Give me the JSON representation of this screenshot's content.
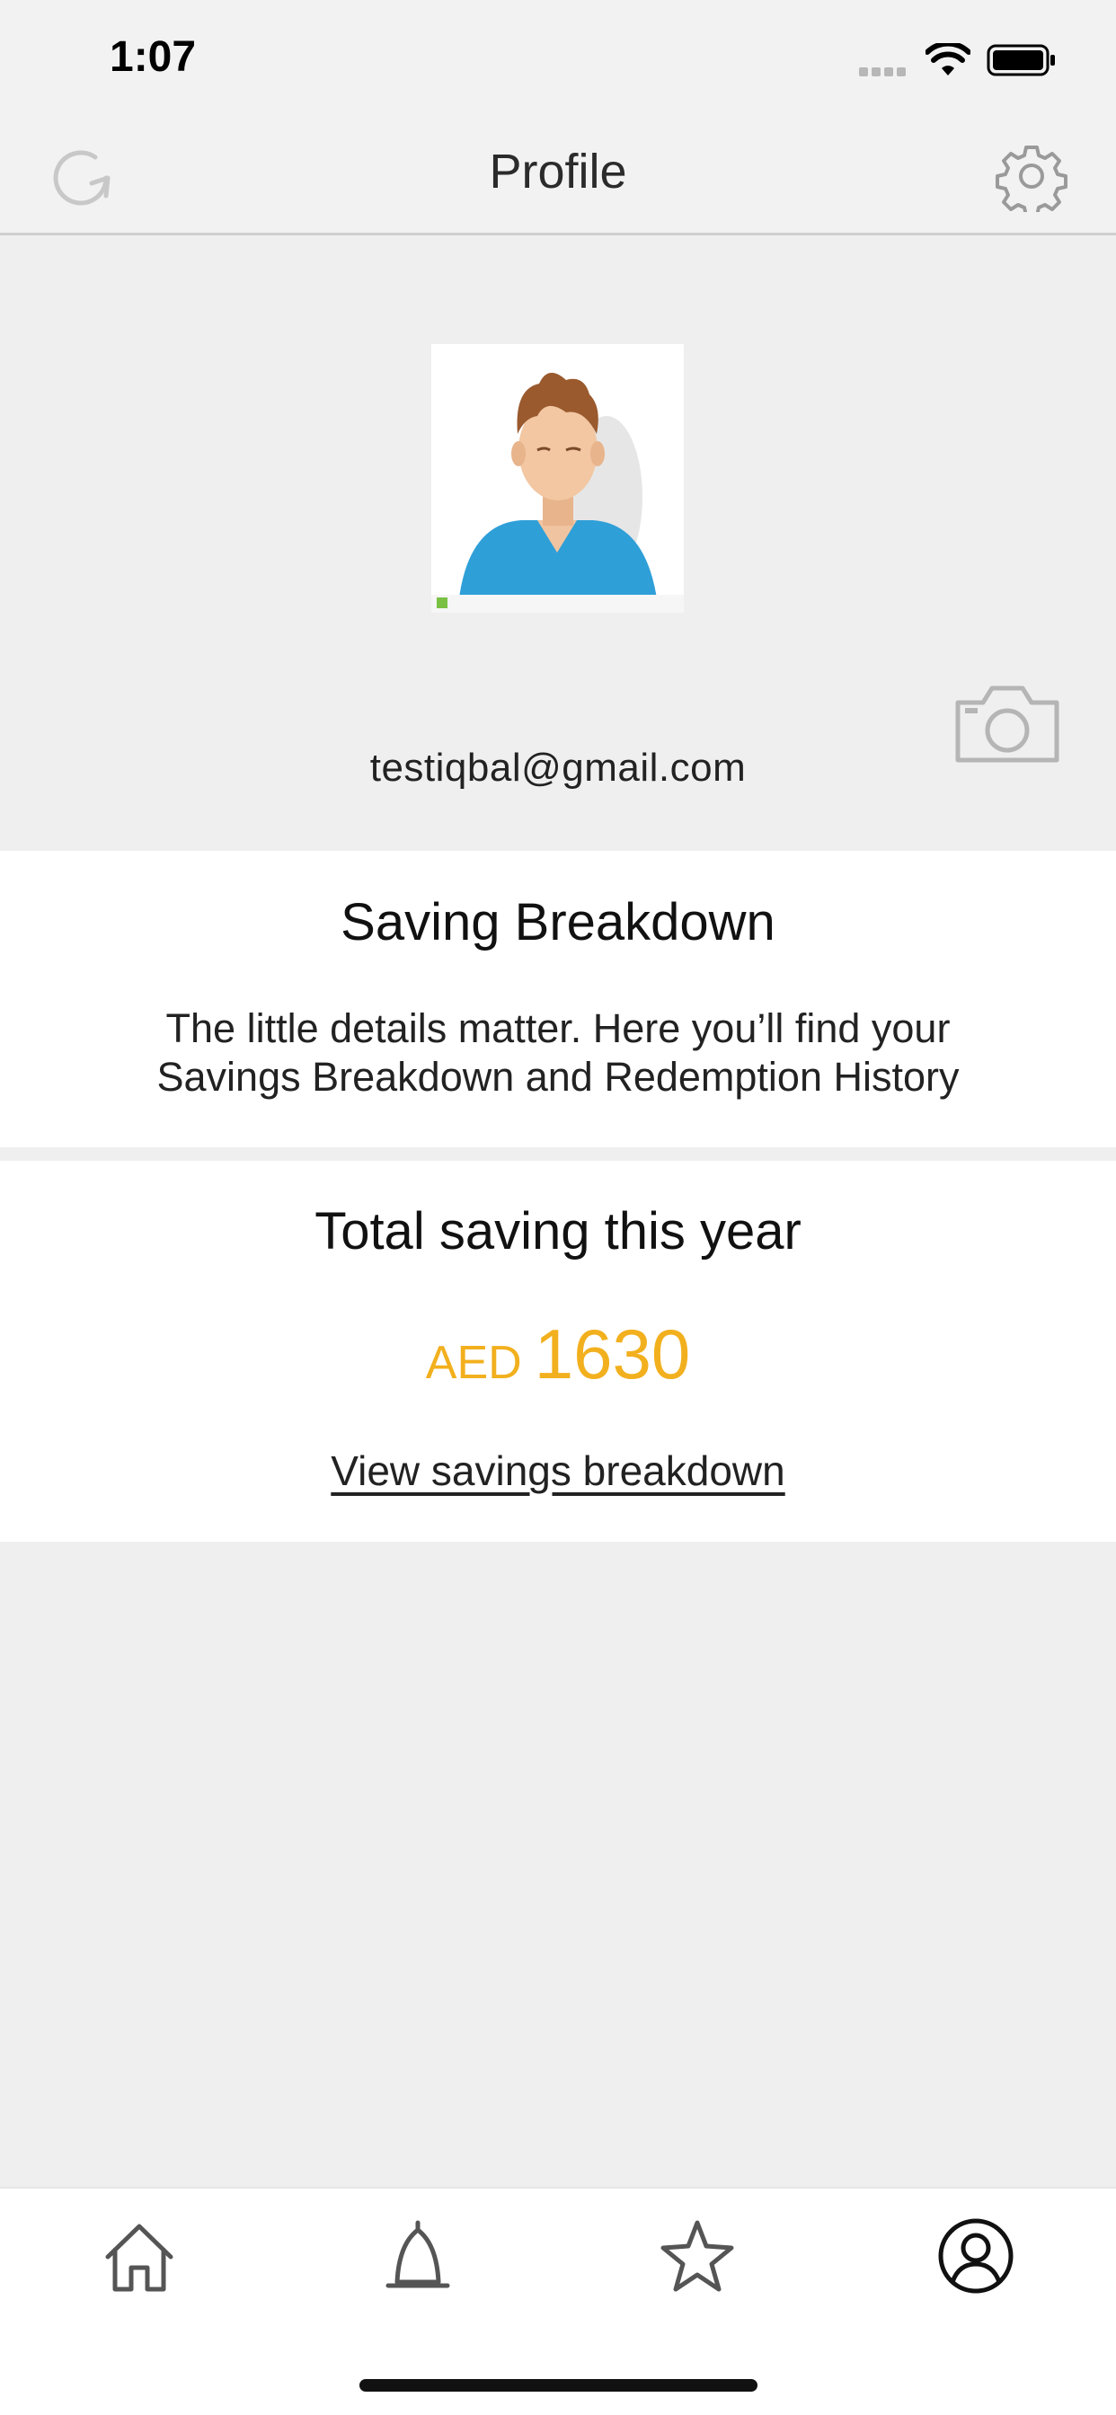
{
  "status_bar": {
    "time": "1:07"
  },
  "header": {
    "title": "Profile"
  },
  "profile": {
    "email": "testiqbal@gmail.com"
  },
  "saving_breakdown": {
    "title": "Saving Breakdown",
    "description": "The little details matter. Here you’ll find your Savings Breakdown and Redemption History"
  },
  "total_saving": {
    "title": "Total saving this year",
    "currency": "AED",
    "amount": "1630",
    "link_label": "View savings breakdown"
  },
  "colors": {
    "accent": "#f2b01e",
    "background": "#efefef",
    "card": "#ffffff"
  },
  "icons": {
    "refresh": "refresh-icon",
    "settings": "gear-icon",
    "camera": "camera-icon",
    "tabs": [
      "home-icon",
      "bell-icon",
      "star-icon",
      "user-circle-icon"
    ]
  }
}
